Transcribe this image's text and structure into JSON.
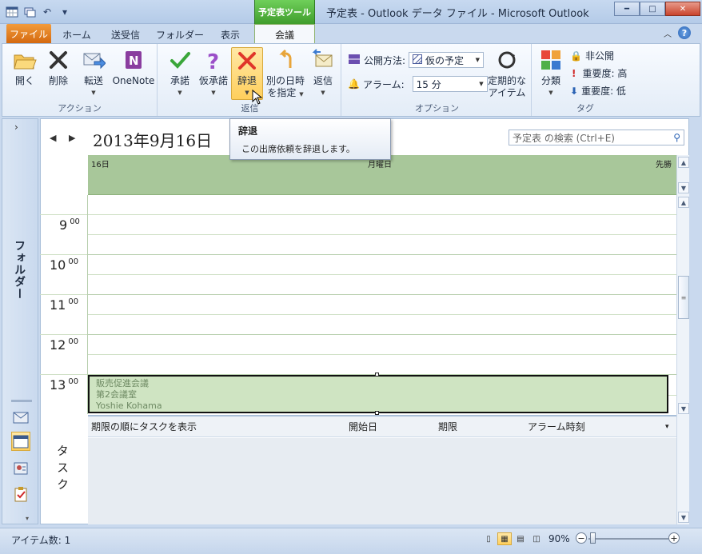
{
  "window": {
    "contextual_tab": "予定表ツール",
    "title": "予定表 - Outlook データ ファイル  -  Microsoft Outlook"
  },
  "tabs": [
    "ファイル",
    "ホーム",
    "送受信",
    "フォルダー",
    "表示",
    "会議"
  ],
  "ribbon": {
    "actions": {
      "label": "アクション",
      "open": "開く",
      "delete": "削除",
      "forward": "転送",
      "onenote": "OneNote"
    },
    "respond": {
      "label": "返信",
      "accept": "承諾",
      "tentative": "仮承諾",
      "decline": "辞退",
      "propose_line1": "別の日時",
      "propose_line2": "を指定",
      "reply": "返信"
    },
    "options": {
      "label": "オプション",
      "show_as_label": "公開方法:",
      "show_as_value": "仮の予定",
      "reminder_label": "アラーム:",
      "reminder_value": "15 分",
      "recurrence_line1": "定期的な",
      "recurrence_line2": "アイテム"
    },
    "tags": {
      "label": "タグ",
      "categorize": "分類",
      "private": "非公開",
      "high_importance": "重要度: 高",
      "low_importance": "重要度: 低"
    }
  },
  "tooltip": {
    "title": "辞退",
    "body": "この出席依頼を辞退します。"
  },
  "nav": {
    "folders_label": "フォルダー"
  },
  "calendar": {
    "date_heading": "2013年9月16日",
    "search_placeholder": "予定表 の検索 (Ctrl+E)",
    "day_number": "16日",
    "weekday": "月曜日",
    "rokuyo": "先勝",
    "hours": [
      {
        "hour": "9",
        "min": "00"
      },
      {
        "hour": "10",
        "min": "00"
      },
      {
        "hour": "11",
        "min": "00"
      },
      {
        "hour": "12",
        "min": "00"
      },
      {
        "hour": "13",
        "min": "00"
      }
    ],
    "appointment": {
      "subject": "販売促進会議",
      "location": "第2会議室",
      "organizer": "Yoshie Kohama"
    }
  },
  "tasks": {
    "side_label": "タスク",
    "header": "期限の順にタスクを表示",
    "col_start": "開始日",
    "col_due": "期限",
    "col_reminder": "アラーム時刻"
  },
  "status": {
    "item_count": "アイテム数: 1",
    "zoom": "90%"
  },
  "colors": {
    "accent_green": "#a8c79a",
    "file_tab": "#e07a1e",
    "appointment_bg": "#cfe4c2"
  }
}
